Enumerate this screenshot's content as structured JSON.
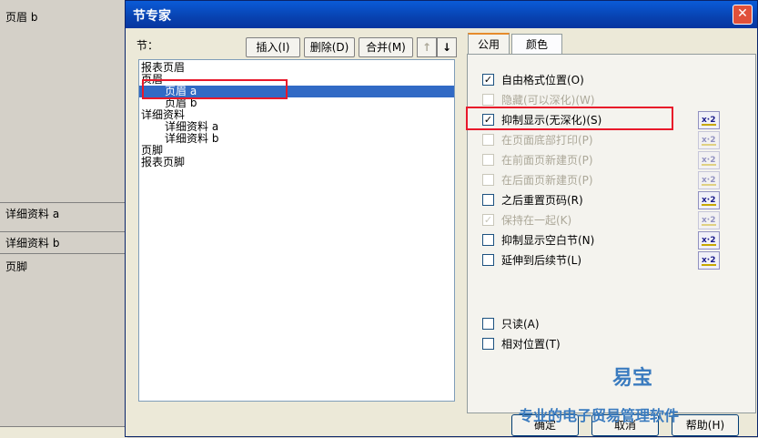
{
  "background": {
    "sections": [
      "页眉 b",
      "详细资料 a",
      "详细资料 b",
      "页脚"
    ]
  },
  "dialog": {
    "title": "节专家",
    "close_glyph": "✕",
    "sections_label": "节：",
    "buttons": {
      "insert": "插入(I)",
      "delete": "删除(D)",
      "merge": "合并(M)"
    },
    "tree": [
      {
        "label": "报表页眉",
        "indent": 0
      },
      {
        "label": "页眉",
        "indent": 0
      },
      {
        "label": "页眉 a",
        "indent": 2,
        "selected": true
      },
      {
        "label": "页眉 b",
        "indent": 2
      },
      {
        "label": "详细资料",
        "indent": 0
      },
      {
        "label": "详细资料 a",
        "indent": 2
      },
      {
        "label": "详细资料 b",
        "indent": 2
      },
      {
        "label": "页脚",
        "indent": 0
      },
      {
        "label": "报表页脚",
        "indent": 0
      }
    ],
    "tabs": [
      "公用",
      "颜色"
    ],
    "active_tab": "公用",
    "options": [
      {
        "label": "自由格式位置(O)",
        "checked": true,
        "enabled": true,
        "formula": false
      },
      {
        "label": "隐藏(可以深化)(W)",
        "checked": false,
        "enabled": false,
        "formula": false
      },
      {
        "label": "抑制显示(无深化)(S)",
        "checked": true,
        "enabled": true,
        "formula": true
      },
      {
        "label": "在页面底部打印(P)",
        "checked": false,
        "enabled": false,
        "formula": "disabled"
      },
      {
        "label": "在前面页新建页(P)",
        "checked": false,
        "enabled": false,
        "formula": "disabled"
      },
      {
        "label": "在后面页新建页(P)",
        "checked": false,
        "enabled": false,
        "formula": "disabled"
      },
      {
        "label": "之后重置页码(R)",
        "checked": false,
        "enabled": true,
        "formula": true
      },
      {
        "label": "保持在一起(K)",
        "checked": true,
        "enabled": false,
        "formula": "disabled"
      },
      {
        "label": "抑制显示空白节(N)",
        "checked": false,
        "enabled": true,
        "formula": true
      },
      {
        "label": "延伸到后续节(L)",
        "checked": false,
        "enabled": true,
        "formula": true
      },
      {
        "label": "只读(A)",
        "checked": false,
        "enabled": true,
        "formula": false
      },
      {
        "label": "相对位置(T)",
        "checked": false,
        "enabled": true,
        "formula": false
      }
    ],
    "formula_icon": "x-2",
    "footer": {
      "ok": "确定",
      "cancel": "取消",
      "help": "帮助(H)"
    }
  },
  "watermark": {
    "line1": "易宝",
    "line2": "专业的电子贸易管理软件"
  },
  "colors": {
    "title_bar": "#0842b0",
    "selection": "#316ac5",
    "highlight_box": "#e8182a",
    "watermark": "#3a7bbf"
  }
}
